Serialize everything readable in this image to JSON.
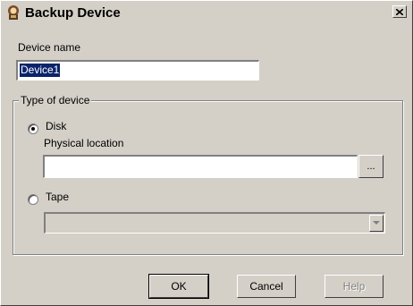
{
  "window": {
    "title": "Backup Device"
  },
  "device_name": {
    "label": "Device name",
    "value": "Device1"
  },
  "device_type": {
    "group_label": "Type of device",
    "disk": {
      "label": "Disk",
      "selected": true
    },
    "physical_location": {
      "label": "Physical location",
      "value": "",
      "browse_label": "..."
    },
    "tape": {
      "label": "Tape",
      "selected": false,
      "value": ""
    }
  },
  "buttons": {
    "ok": "OK",
    "cancel": "Cancel",
    "help": "Help"
  },
  "icons": {
    "title": "backup-device-icon",
    "close": "close-icon",
    "dropdown": "chevron-down-icon"
  },
  "colors": {
    "dialog_bg": "#d4d0c8",
    "selection": "#0a246a"
  }
}
